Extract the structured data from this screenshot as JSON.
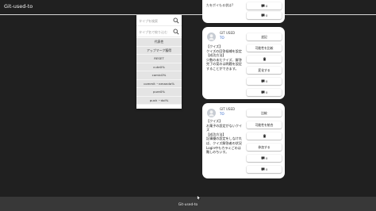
{
  "app": {
    "title": "Git-used-to"
  },
  "filter": {
    "search_placeholder": "タイプを検索",
    "sub_placeholder": "タイプ名で絞り込む",
    "tags": [
      "代表性",
      "アップマーク獲得",
      "RESET",
      "cute0%",
      "comic0%",
      "commit ~amanda%",
      "pure0%",
      "push ~dol%"
    ]
  },
  "top_card": {
    "text": "たをポイもる状は?",
    "buttons": [
      {
        "icon": "comment-icon",
        "label": "0"
      },
      {
        "icon": "comment-icon",
        "label": "0"
      }
    ]
  },
  "posts": [
    {
      "user_name": "GIT USED",
      "user_sub": "TO",
      "body": "【クイズ】\nクイズの回答候補を設定\n【成功方法】\n少数の未だクイズ、解答完了の案のは問題を設定することができます。",
      "buttons": [
        {
          "icon": "",
          "label": "追記"
        },
        {
          "icon": "",
          "label": "可能性を比較"
        },
        {
          "icon": "trash-icon",
          "label": ""
        },
        {
          "icon": "",
          "label": "変化する"
        },
        {
          "icon": "comment-icon",
          "label": "0"
        },
        {
          "icon": "comment-icon",
          "label": "0"
        }
      ]
    },
    {
      "user_name": "GIT USED",
      "user_sub": "TO",
      "body": "【クイズ】\nお菓子の設定がないクイズ\n【成功方法】\n記事優の設定をしなければ、クイズ解答者の状況Login中もカラミごのは難しのちいす。",
      "buttons": [
        {
          "icon": "",
          "label": "比較"
        },
        {
          "icon": "",
          "label": "可能性を統合"
        },
        {
          "icon": "trash-icon",
          "label": ""
        },
        {
          "icon": "",
          "label": "参加する"
        },
        {
          "icon": "comment-icon",
          "label": "0"
        },
        {
          "icon": "comment-icon",
          "label": "0"
        }
      ]
    }
  ],
  "footer": {
    "text": "Git-used-to"
  }
}
